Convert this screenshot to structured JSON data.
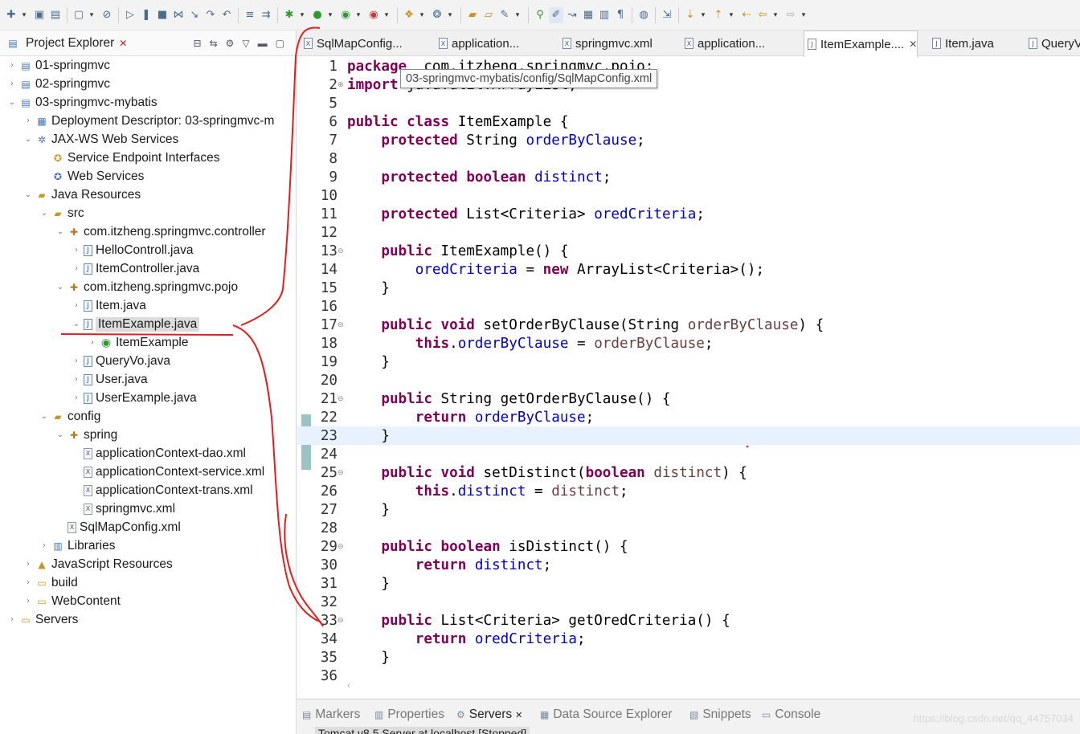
{
  "toolbar": {
    "icons": [
      "new-icon",
      "save-icon",
      "save-all-icon",
      "screen-icon",
      "skip-breakpoints-icon",
      "resume-icon",
      "suspend-icon",
      "terminate-icon",
      "disconnect-icon",
      "step-into-icon",
      "step-over-icon",
      "step-return-icon",
      "drop-frame-icon",
      "use-step-filters-icon",
      "debug-icon",
      "run-icon",
      "coverage-icon",
      "external-tools-icon",
      "new-server-icon",
      "new-class-icon",
      "open-type-icon",
      "open-task-icon",
      "search-icon",
      "next-annotation-icon",
      "highlight-icon",
      "toggle-mark-icon",
      "block-selection-icon",
      "show-whitespace-icon",
      "web-browser-icon",
      "open-perspective-icon",
      "next-edit-icon",
      "prev-edit-icon",
      "back-icon",
      "forward-icon"
    ]
  },
  "explorer": {
    "title": "Project Explorer",
    "items": [
      {
        "label": "01-springmvc",
        "depth": 0,
        "twisty": "closed",
        "icon": "project-icon"
      },
      {
        "label": "02-springmvc",
        "depth": 0,
        "twisty": "closed",
        "icon": "project-icon"
      },
      {
        "label": "03-springmvc-mybatis",
        "depth": 0,
        "twisty": "open",
        "icon": "project-icon"
      },
      {
        "label": "Deployment Descriptor: 03-springmvc-m",
        "depth": 1,
        "twisty": "closed",
        "icon": "deployment-descriptor-icon"
      },
      {
        "label": "JAX-WS Web Services",
        "depth": 1,
        "twisty": "open",
        "icon": "web-services-icon"
      },
      {
        "label": "Service Endpoint Interfaces",
        "depth": 2,
        "twisty": "none",
        "icon": "service-endpoint-icon"
      },
      {
        "label": "Web Services",
        "depth": 2,
        "twisty": "none",
        "icon": "web-service-icon"
      },
      {
        "label": "Java Resources",
        "depth": 1,
        "twisty": "open",
        "icon": "java-resources-icon"
      },
      {
        "label": "src",
        "depth": 2,
        "twisty": "open",
        "icon": "source-folder-icon"
      },
      {
        "label": "com.itzheng.springmvc.controller",
        "depth": 3,
        "twisty": "open",
        "icon": "package-icon"
      },
      {
        "label": "HelloControll.java",
        "depth": 4,
        "twisty": "closed",
        "icon": "java-file-icon"
      },
      {
        "label": "ItemController.java",
        "depth": 4,
        "twisty": "closed",
        "icon": "java-file-icon"
      },
      {
        "label": "com.itzheng.springmvc.pojo",
        "depth": 3,
        "twisty": "open",
        "icon": "package-icon"
      },
      {
        "label": "Item.java",
        "depth": 4,
        "twisty": "closed",
        "icon": "java-file-icon"
      },
      {
        "label": "ItemExample.java",
        "depth": 4,
        "twisty": "open",
        "icon": "java-file-icon",
        "selected": true
      },
      {
        "label": "ItemExample",
        "depth": 5,
        "twisty": "closed",
        "icon": "class-icon"
      },
      {
        "label": "QueryVo.java",
        "depth": 4,
        "twisty": "closed",
        "icon": "java-file-icon"
      },
      {
        "label": "User.java",
        "depth": 4,
        "twisty": "closed",
        "icon": "java-file-icon"
      },
      {
        "label": "UserExample.java",
        "depth": 4,
        "twisty": "closed",
        "icon": "java-file-icon"
      },
      {
        "label": "config",
        "depth": 2,
        "twisty": "open",
        "icon": "source-folder-icon"
      },
      {
        "label": "spring",
        "depth": 3,
        "twisty": "open",
        "icon": "package-icon"
      },
      {
        "label": "applicationContext-dao.xml",
        "depth": 4,
        "twisty": "none",
        "icon": "xml-file-icon"
      },
      {
        "label": "applicationContext-service.xml",
        "depth": 4,
        "twisty": "none",
        "icon": "xml-file-icon"
      },
      {
        "label": "applicationContext-trans.xml",
        "depth": 4,
        "twisty": "none",
        "icon": "xml-file-icon"
      },
      {
        "label": "springmvc.xml",
        "depth": 4,
        "twisty": "none",
        "icon": "xml-file-icon"
      },
      {
        "label": "SqlMapConfig.xml",
        "depth": 3,
        "twisty": "none",
        "icon": "xml-file-icon"
      },
      {
        "label": "Libraries",
        "depth": 2,
        "twisty": "closed",
        "icon": "libraries-icon"
      },
      {
        "label": "JavaScript Resources",
        "depth": 1,
        "twisty": "closed",
        "icon": "javascript-resources-icon"
      },
      {
        "label": "build",
        "depth": 1,
        "twisty": "closed",
        "icon": "folder-icon"
      },
      {
        "label": "WebContent",
        "depth": 1,
        "twisty": "closed",
        "icon": "folder-icon"
      },
      {
        "label": "Servers",
        "depth": 0,
        "twisty": "closed",
        "icon": "folder-icon"
      }
    ]
  },
  "editor_tabs": [
    {
      "label": "SqlMapConfig...",
      "active": false
    },
    {
      "label": "application...",
      "active": false
    },
    {
      "label": "springmvc.xml",
      "active": false
    },
    {
      "label": "application...",
      "active": false
    },
    {
      "label": "ItemExample....",
      "active": true
    },
    {
      "label": "Item.java",
      "active": false
    },
    {
      "label": "QueryV",
      "active": false
    }
  ],
  "tooltip": "03-springmvc-mybatis/config/SqlMapConfig.xml",
  "code_lines": [
    {
      "n": "1",
      "fold": "",
      "segs": [
        [
          "kw",
          "package"
        ],
        [
          "",
          "  com.itzheng.springmvc.pojo;"
        ]
      ]
    },
    {
      "n": "2",
      "fold": "plus",
      "segs": [
        [
          "kw",
          "import"
        ],
        [
          "",
          " java.util.ArrayList;"
        ]
      ]
    },
    {
      "n": "5",
      "fold": "",
      "segs": []
    },
    {
      "n": "6",
      "fold": "",
      "segs": [
        [
          "kw",
          "public"
        ],
        [
          "",
          " "
        ],
        [
          "kw",
          "class"
        ],
        [
          "",
          " ItemExample {"
        ]
      ]
    },
    {
      "n": "7",
      "fold": "",
      "segs": [
        [
          "",
          "    "
        ],
        [
          "kw",
          "protected"
        ],
        [
          "",
          " String "
        ],
        [
          "fld",
          "orderByClause"
        ],
        [
          "",
          ";"
        ]
      ]
    },
    {
      "n": "8",
      "fold": "",
      "segs": []
    },
    {
      "n": "9",
      "fold": "",
      "segs": [
        [
          "",
          "    "
        ],
        [
          "kw",
          "protected"
        ],
        [
          "",
          " "
        ],
        [
          "kw",
          "boolean"
        ],
        [
          "",
          " "
        ],
        [
          "fld",
          "distinct"
        ],
        [
          "",
          ";"
        ]
      ]
    },
    {
      "n": "10",
      "fold": "",
      "segs": []
    },
    {
      "n": "11",
      "fold": "",
      "segs": [
        [
          "",
          "    "
        ],
        [
          "kw",
          "protected"
        ],
        [
          "",
          " List<Criteria> "
        ],
        [
          "fld",
          "oredCriteria"
        ],
        [
          "",
          ";"
        ]
      ]
    },
    {
      "n": "12",
      "fold": "",
      "segs": []
    },
    {
      "n": "13",
      "fold": "minus",
      "segs": [
        [
          "",
          "    "
        ],
        [
          "kw",
          "public"
        ],
        [
          "",
          " ItemExample() {"
        ]
      ]
    },
    {
      "n": "14",
      "fold": "",
      "segs": [
        [
          "",
          "        "
        ],
        [
          "fld",
          "oredCriteria"
        ],
        [
          "",
          " = "
        ],
        [
          "kw",
          "new"
        ],
        [
          "",
          " ArrayList<Criteria>();"
        ]
      ]
    },
    {
      "n": "15",
      "fold": "",
      "segs": [
        [
          "",
          "    }"
        ]
      ]
    },
    {
      "n": "16",
      "fold": "",
      "segs": []
    },
    {
      "n": "17",
      "fold": "minus",
      "segs": [
        [
          "",
          "    "
        ],
        [
          "kw",
          "public"
        ],
        [
          "",
          " "
        ],
        [
          "kw",
          "void"
        ],
        [
          "",
          " setOrderByClause(String "
        ],
        [
          "par",
          "orderByClause"
        ],
        [
          "",
          ") {"
        ]
      ]
    },
    {
      "n": "18",
      "fold": "",
      "segs": [
        [
          "",
          "        "
        ],
        [
          "kw",
          "this"
        ],
        [
          "",
          "."
        ],
        [
          "fld",
          "orderByClause"
        ],
        [
          "",
          " = "
        ],
        [
          "par",
          "orderByClause"
        ],
        [
          "",
          ";"
        ]
      ]
    },
    {
      "n": "19",
      "fold": "",
      "segs": [
        [
          "",
          "    }"
        ]
      ]
    },
    {
      "n": "20",
      "fold": "",
      "segs": []
    },
    {
      "n": "21",
      "fold": "minus",
      "segs": [
        [
          "",
          "    "
        ],
        [
          "kw",
          "public"
        ],
        [
          "",
          " String getOrderByClause() {"
        ]
      ]
    },
    {
      "n": "22",
      "fold": "",
      "segs": [
        [
          "",
          "        "
        ],
        [
          "kw",
          "return"
        ],
        [
          "",
          " "
        ],
        [
          "fld",
          "orderByClause"
        ],
        [
          "",
          ";"
        ]
      ]
    },
    {
      "n": "23",
      "fold": "",
      "segs": [
        [
          "",
          "    }"
        ]
      ],
      "current": true
    },
    {
      "n": "24",
      "fold": "",
      "segs": []
    },
    {
      "n": "25",
      "fold": "minus",
      "segs": [
        [
          "",
          "    "
        ],
        [
          "kw",
          "public"
        ],
        [
          "",
          " "
        ],
        [
          "kw",
          "void"
        ],
        [
          "",
          " setDistinct("
        ],
        [
          "kw",
          "boolean"
        ],
        [
          "",
          " "
        ],
        [
          "par",
          "distinct"
        ],
        [
          "",
          ") {"
        ]
      ]
    },
    {
      "n": "26",
      "fold": "",
      "segs": [
        [
          "",
          "        "
        ],
        [
          "kw",
          "this"
        ],
        [
          "",
          "."
        ],
        [
          "fld",
          "distinct"
        ],
        [
          "",
          " = "
        ],
        [
          "par",
          "distinct"
        ],
        [
          "",
          ";"
        ]
      ]
    },
    {
      "n": "27",
      "fold": "",
      "segs": [
        [
          "",
          "    }"
        ]
      ]
    },
    {
      "n": "28",
      "fold": "",
      "segs": []
    },
    {
      "n": "29",
      "fold": "minus",
      "segs": [
        [
          "",
          "    "
        ],
        [
          "kw",
          "public"
        ],
        [
          "",
          " "
        ],
        [
          "kw",
          "boolean"
        ],
        [
          "",
          " isDistinct() {"
        ]
      ]
    },
    {
      "n": "30",
      "fold": "",
      "segs": [
        [
          "",
          "        "
        ],
        [
          "kw",
          "return"
        ],
        [
          "",
          " "
        ],
        [
          "fld",
          "distinct"
        ],
        [
          "",
          ";"
        ]
      ]
    },
    {
      "n": "31",
      "fold": "",
      "segs": [
        [
          "",
          "    }"
        ]
      ]
    },
    {
      "n": "32",
      "fold": "",
      "segs": []
    },
    {
      "n": "33",
      "fold": "minus",
      "segs": [
        [
          "",
          "    "
        ],
        [
          "kw",
          "public"
        ],
        [
          "",
          " List<Criteria> getOredCriteria() {"
        ]
      ]
    },
    {
      "n": "34",
      "fold": "",
      "segs": [
        [
          "",
          "        "
        ],
        [
          "kw",
          "return"
        ],
        [
          "",
          " "
        ],
        [
          "fld",
          "oredCriteria"
        ],
        [
          "",
          ";"
        ]
      ]
    },
    {
      "n": "35",
      "fold": "",
      "segs": [
        [
          "",
          "    }"
        ]
      ]
    },
    {
      "n": "36",
      "fold": "",
      "segs": []
    }
  ],
  "bottom_tabs": [
    {
      "label": "Markers",
      "icon": "markers-icon",
      "active": false
    },
    {
      "label": "Properties",
      "icon": "properties-icon",
      "active": false
    },
    {
      "label": "Servers",
      "icon": "servers-icon",
      "active": true
    },
    {
      "label": "Data Source Explorer",
      "icon": "data-source-icon",
      "active": false
    },
    {
      "label": "Snippets",
      "icon": "snippets-icon",
      "active": false
    },
    {
      "label": "Console",
      "icon": "console-icon",
      "active": false
    }
  ],
  "server_entry": "Tomcat v8.5 Server at localhost  [Stopped]",
  "watermark": "https://blog.csdn.net/qq_44757034",
  "colors": {
    "keyword": "#7f0055",
    "field": "#0000c0",
    "parameter": "#6a3e3e",
    "annotation_red": "#e02020",
    "current_line": "#e8f2fe"
  }
}
